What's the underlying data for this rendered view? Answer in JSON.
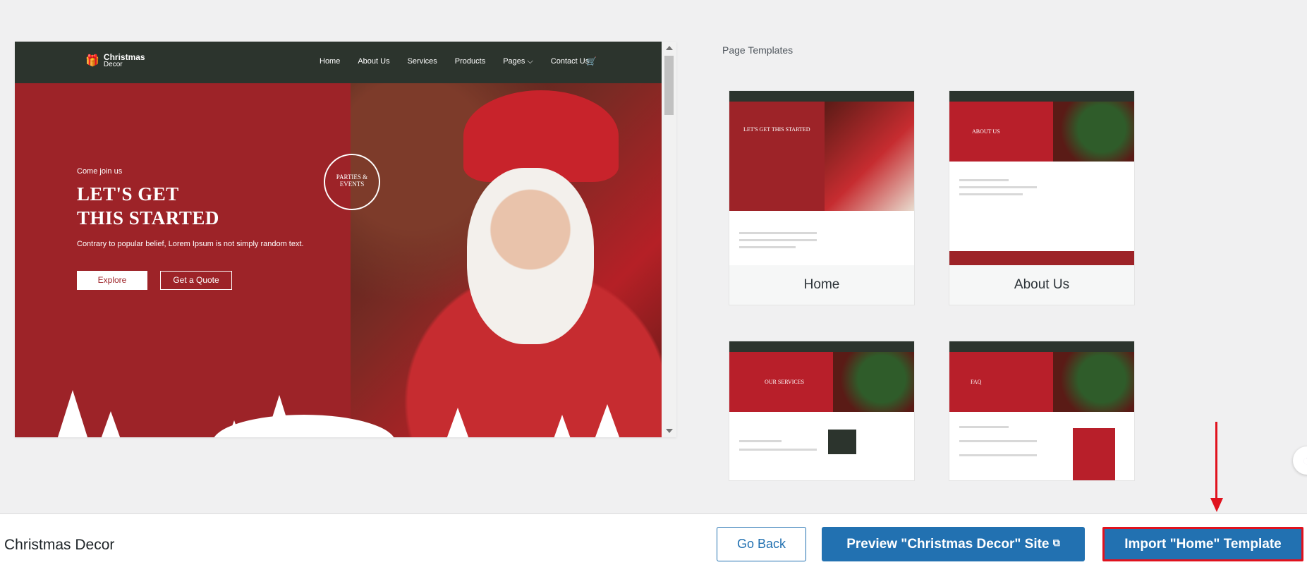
{
  "preview": {
    "logo_title": "Christmas",
    "logo_sub": "Decor",
    "menu": [
      "Home",
      "About Us",
      "Services",
      "Products",
      "Pages ⌵",
      "Contact Us"
    ],
    "cart_icon": "cart-icon",
    "hero_kicker": "Come join us",
    "hero_title_line1": "Let's Get",
    "hero_title_line2": "This Started",
    "hero_text": "Contrary to popular belief, Lorem Ipsum is not simply random text.",
    "badge_text": "PARTIES & EVENTS",
    "explore_label": "Explore",
    "quote_label": "Get a Quote"
  },
  "panel": {
    "title": "Page Templates",
    "templates": [
      {
        "label": "Home",
        "banner": "LET'S GET THIS STARTED"
      },
      {
        "label": "About Us",
        "banner": "ABOUT US"
      },
      {
        "label": "",
        "banner": "OUR SERVICES"
      },
      {
        "label": "",
        "banner": "FAQ"
      }
    ]
  },
  "footer": {
    "site_name": "Christmas Decor",
    "back_label": "Go Back",
    "preview_label": "Preview \"Christmas Decor\" Site",
    "import_label": "Import \"Home\" Template"
  },
  "colors": {
    "accent": "#2271b1",
    "hero_red": "#9d2328",
    "nav_dark": "#2c342d",
    "highlight": "#e0121e"
  }
}
